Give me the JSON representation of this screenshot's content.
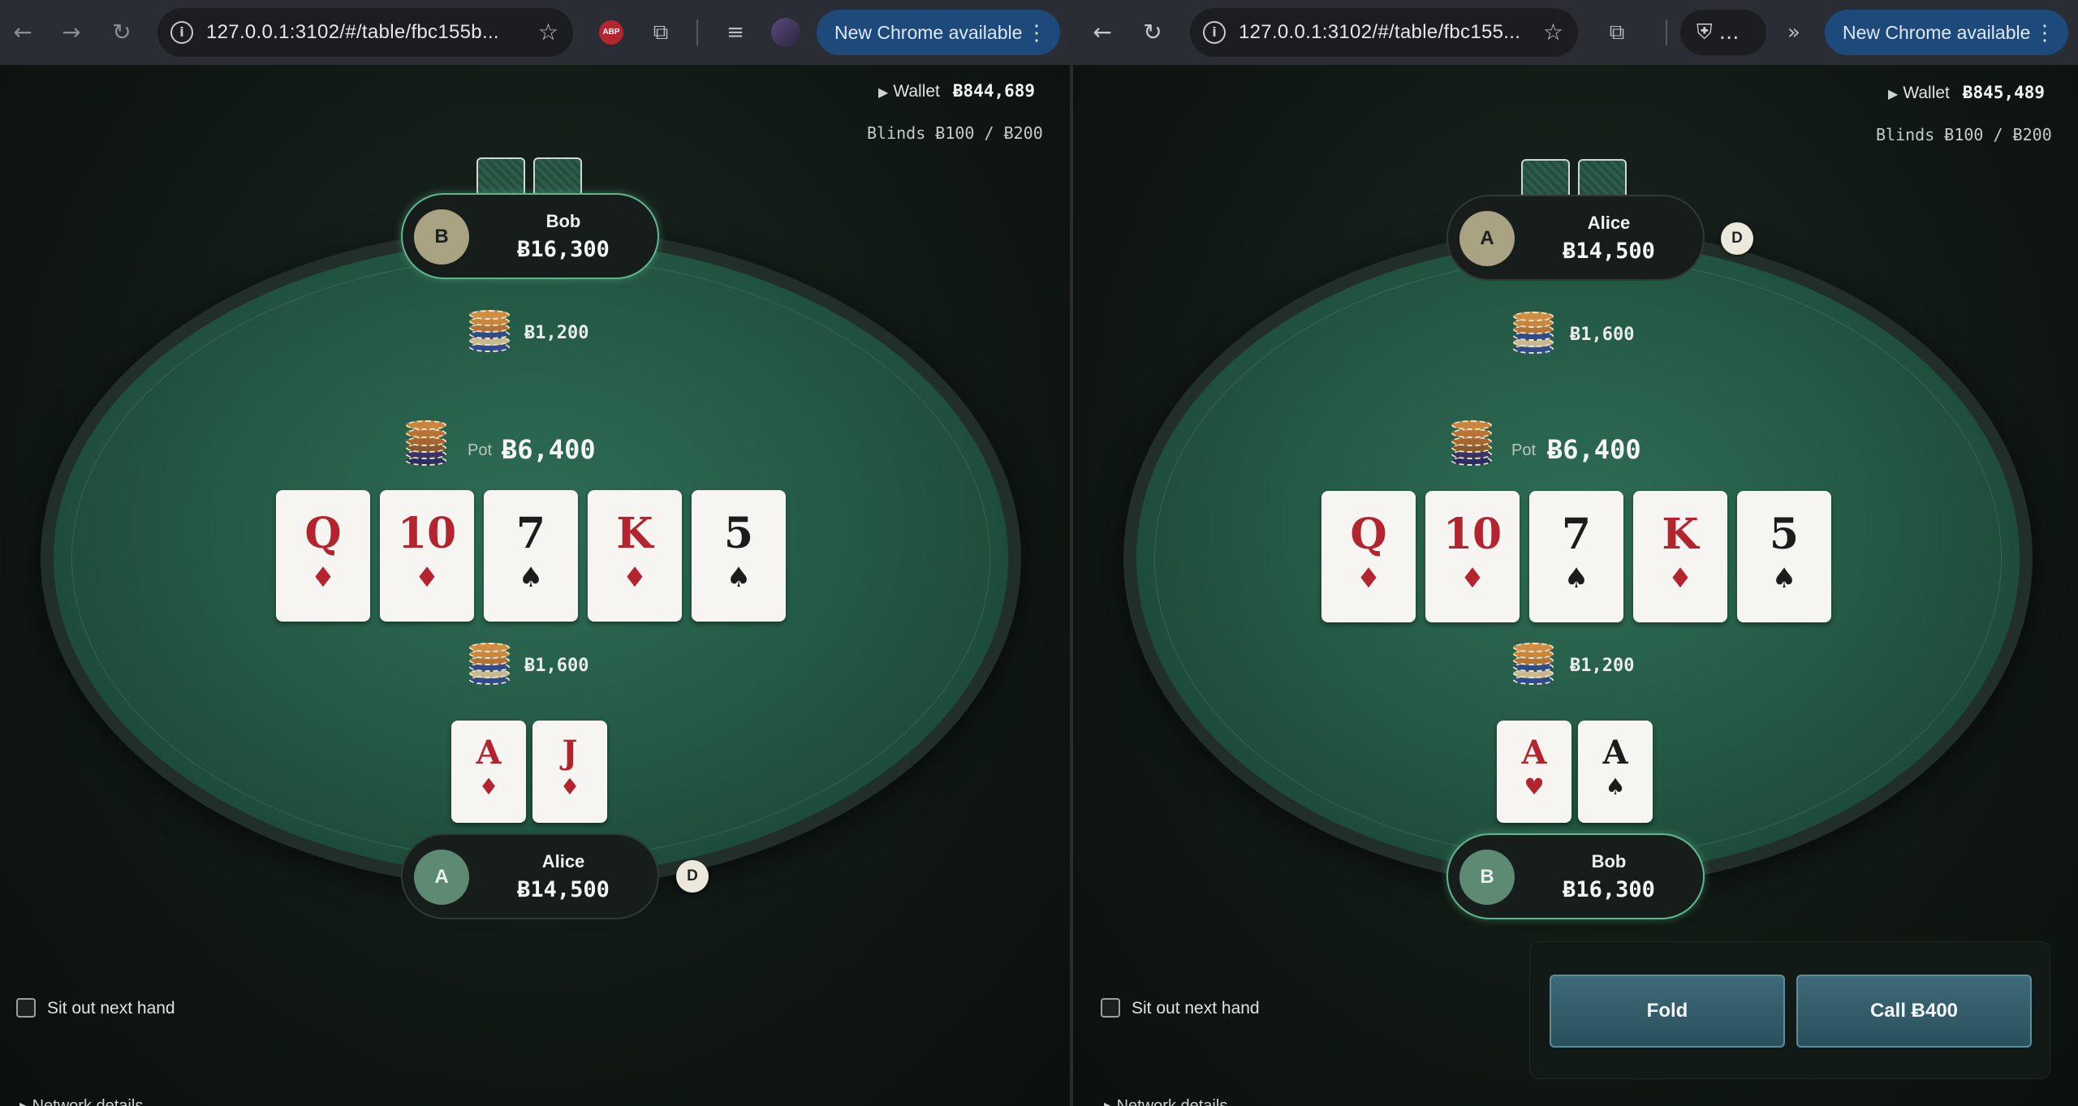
{
  "left": {
    "toolbar": {
      "url": "127.0.0.1:3102/#/table/fbc155b...",
      "update_label": "New Chrome available",
      "abp_label": "ABP"
    },
    "wallet": {
      "label": "Wallet",
      "amount": "Ƀ844,689"
    },
    "blinds": "Blinds Ƀ100 / Ƀ200",
    "top_seat": {
      "initial": "B",
      "name": "Bob",
      "stack": "Ƀ16,300",
      "active": true,
      "avatar_color": "#a9a283"
    },
    "top_bet": "Ƀ1,200",
    "pot": {
      "label": "Pot",
      "amount": "Ƀ6,400"
    },
    "board": [
      {
        "rank": "Q",
        "suit": "♦",
        "color": "red"
      },
      {
        "rank": "10",
        "suit": "♦",
        "color": "red"
      },
      {
        "rank": "7",
        "suit": "♠",
        "color": "black"
      },
      {
        "rank": "K",
        "suit": "♦",
        "color": "red"
      },
      {
        "rank": "5",
        "suit": "♠",
        "color": "black"
      }
    ],
    "bottom_bet": "Ƀ1,600",
    "hole_cards": [
      {
        "rank": "A",
        "suit": "♦",
        "color": "red"
      },
      {
        "rank": "J",
        "suit": "♦",
        "color": "red"
      }
    ],
    "bottom_seat": {
      "initial": "A",
      "name": "Alice",
      "stack": "Ƀ14,500",
      "active": false,
      "avatar_color": "#5e8a74"
    },
    "dealer_label": "D",
    "sit_out": "Sit out next hand",
    "network": "▸ Network details"
  },
  "right": {
    "toolbar": {
      "url": "127.0.0.1:3102/#/table/fbc155...",
      "update_label": "New Chrome available",
      "incognito_label": "..."
    },
    "wallet": {
      "label": "Wallet",
      "amount": "Ƀ845,489"
    },
    "blinds": "Blinds Ƀ100 / Ƀ200",
    "top_seat": {
      "initial": "A",
      "name": "Alice",
      "stack": "Ƀ14,500",
      "active": false,
      "avatar_color": "#a9a283"
    },
    "top_bet": "Ƀ1,600",
    "pot": {
      "label": "Pot",
      "amount": "Ƀ6,400"
    },
    "board": [
      {
        "rank": "Q",
        "suit": "♦",
        "color": "red"
      },
      {
        "rank": "10",
        "suit": "♦",
        "color": "red"
      },
      {
        "rank": "7",
        "suit": "♠",
        "color": "black"
      },
      {
        "rank": "K",
        "suit": "♦",
        "color": "red"
      },
      {
        "rank": "5",
        "suit": "♠",
        "color": "black"
      }
    ],
    "bottom_bet": "Ƀ1,200",
    "hole_cards": [
      {
        "rank": "A",
        "suit": "♥",
        "color": "red"
      },
      {
        "rank": "A",
        "suit": "♠",
        "color": "black"
      }
    ],
    "bottom_seat": {
      "initial": "B",
      "name": "Bob",
      "stack": "Ƀ16,300",
      "active": true,
      "avatar_color": "#5e8a74"
    },
    "dealer_label": "D",
    "sit_out": "Sit out next hand",
    "network": "▸ Network details",
    "actions": {
      "fold": "Fold",
      "call": "Call Ƀ400"
    }
  }
}
